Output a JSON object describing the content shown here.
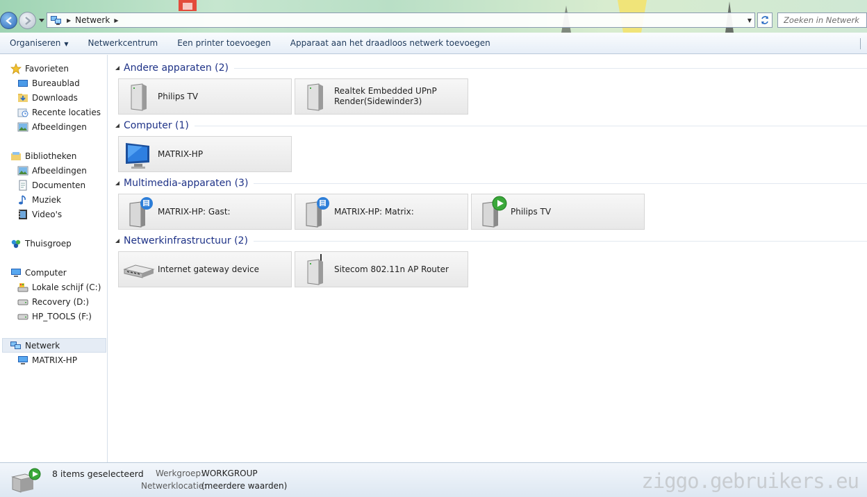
{
  "address": {
    "breadcrumb": "Netwerk",
    "search_placeholder": "Zoeken in Netwerk"
  },
  "commands": {
    "organize": "Organiseren",
    "network_center": "Netwerkcentrum",
    "add_printer": "Een printer toevoegen",
    "add_wireless": "Apparaat aan het draadloos netwerk toevoegen"
  },
  "sidebar": {
    "favorites": "Favorieten",
    "desktop": "Bureaublad",
    "downloads": "Downloads",
    "recent": "Recente locaties",
    "fav_pictures": "Afbeeldingen",
    "libraries": "Bibliotheken",
    "lib_pictures": "Afbeeldingen",
    "documents": "Documenten",
    "music": "Muziek",
    "videos": "Video's",
    "homegroup": "Thuisgroep",
    "computer": "Computer",
    "drive_c": "Lokale schijf (C:)",
    "drive_d": "Recovery (D:)",
    "drive_f": "HP_TOOLS (F:)",
    "network": "Netwerk",
    "network_pc": "MATRIX-HP"
  },
  "groups": {
    "other": {
      "title": "Andere apparaten (2)",
      "items": [
        "Philips TV",
        "Realtek Embedded UPnP Render(Sidewinder3)"
      ]
    },
    "computer": {
      "title": "Computer (1)",
      "items": [
        "MATRIX-HP"
      ]
    },
    "multimedia": {
      "title": "Multimedia-apparaten (3)",
      "items": [
        "MATRIX-HP: Gast:",
        "MATRIX-HP: Matrix:",
        "Philips TV"
      ]
    },
    "infra": {
      "title": "Netwerkinfrastructuur (2)",
      "items": [
        "Internet gateway device",
        "Sitecom 802.11n AP Router"
      ]
    }
  },
  "status": {
    "selected": "8 items geselecteerd",
    "workgroup_label": "Werkgroep:",
    "workgroup_value": "WORKGROUP",
    "location_label": "Netwerklocatie:",
    "location_value": "(meerdere waarden)",
    "watermark": "ziggo.gebruikers.eu"
  },
  "colors": {
    "group_title": "#1e3287",
    "command_text": "#1e395b",
    "selection": "#e5ecf5"
  }
}
